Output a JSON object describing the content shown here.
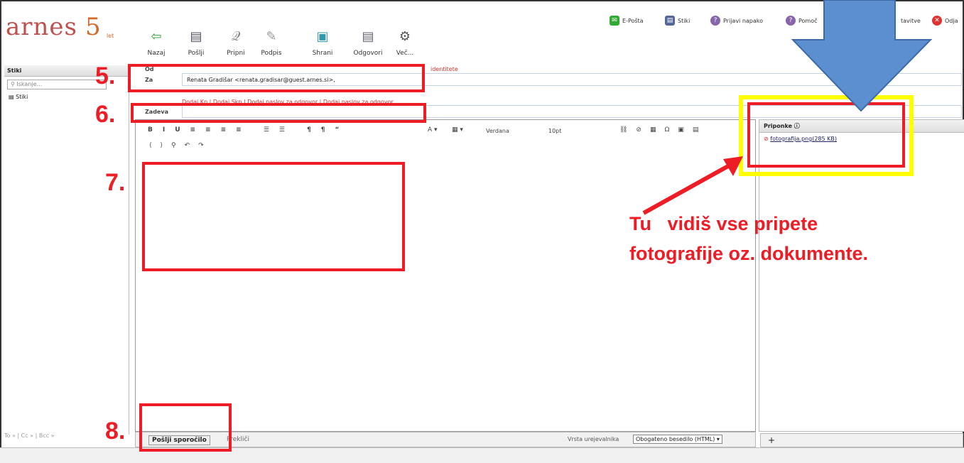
{
  "logo": {
    "text": "arnes",
    "five": "5",
    "let": "let"
  },
  "toolbar": [
    {
      "label": "Nazaj",
      "icon": "back-arrow-icon",
      "glyph": "⇦",
      "color": "#3aa23a"
    },
    {
      "label": "Pošlji",
      "icon": "send-icon",
      "glyph": "▤",
      "color": "#556"
    },
    {
      "label": "Pripni",
      "icon": "paperclip-icon",
      "glyph": "𝒬",
      "color": "#888"
    },
    {
      "label": "Podpis",
      "icon": "signature-icon",
      "glyph": "✎",
      "color": "#999"
    },
    {
      "label": "Shrani",
      "icon": "save-icon",
      "glyph": "▣",
      "color": "#39a"
    },
    {
      "label": "Odgovori",
      "icon": "reply-icon",
      "glyph": "▤",
      "color": "#667"
    },
    {
      "label": "Več...",
      "icon": "gear-icon",
      "glyph": "⚙",
      "color": "#555"
    }
  ],
  "toptools": {
    "email": "E-Pošta",
    "contacts": "Stiki",
    "report": "Prijavi napako",
    "help": "Pomoč",
    "settings": "tavitve",
    "logout": "Odja"
  },
  "sidebar": {
    "title": "Stiki",
    "search_placeholder": "Iskanje...",
    "item": "Stiki",
    "bottom": "To » | Cc » | Bcc »"
  },
  "compose": {
    "from_label": "Od",
    "identity_link": "identitete",
    "to_label": "Za",
    "to_value": "Renata Gradišar <renata.gradisar@guest.arnes.si>,",
    "links": "Dodaj Kp | Dodaj Skp | Dodaj naslov za odgovor | Dodaj naslov za odgovor",
    "subject_label": "Zadeva",
    "subject_value": ""
  },
  "editor": {
    "font": "Verdana",
    "size": "10pt"
  },
  "attachments": {
    "title": "Priponke",
    "file": "fotografija.png",
    "size": "(285 KB)",
    "add": "+"
  },
  "bottom": {
    "send": "Pošlji sporočilo",
    "cancel": "Prekliči",
    "editor_type_label": "Vrsta urejevalnika",
    "editor_type": "Obogateno besedilo (HTML)"
  },
  "annotations": {
    "n5": "5.",
    "n6": "6.",
    "n7": "7.",
    "n8": "8.",
    "line1": "Tu   vidiš vse pripete",
    "line2": "fotografije oz. dokumente."
  },
  "colors": {
    "red": "#ee1c25",
    "yellow": "#ffff00",
    "arrow": "#5b8fd0"
  }
}
